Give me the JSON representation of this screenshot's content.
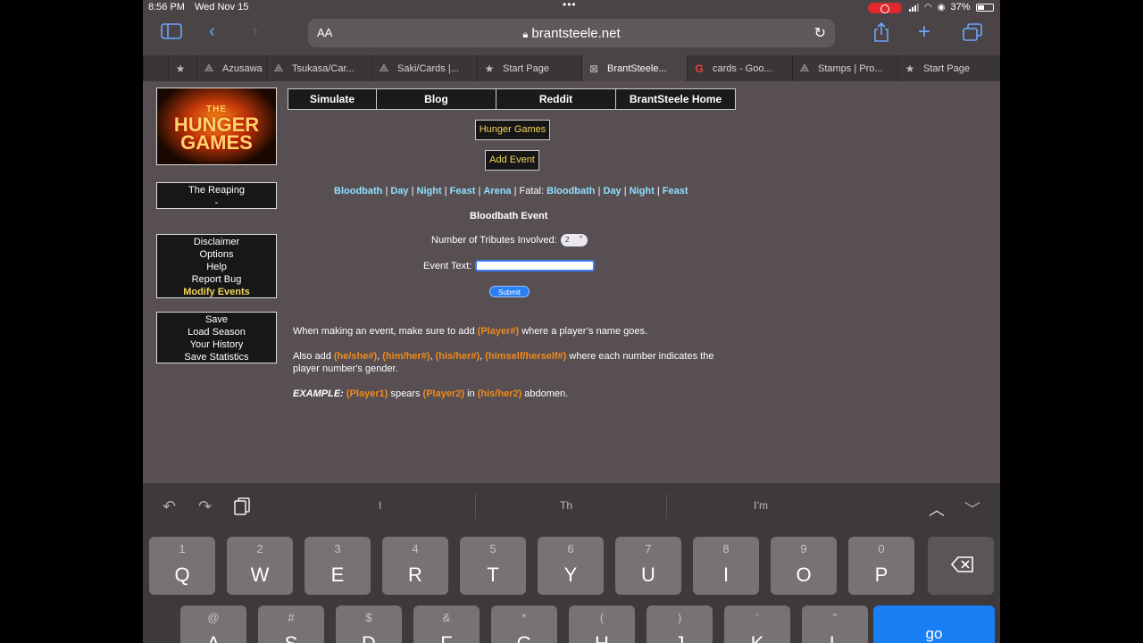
{
  "status": {
    "time": "8:56 PM",
    "date": "Wed Nov 15",
    "battery": "37%"
  },
  "browser": {
    "url": "brantsteele.net",
    "aa_label": "AA",
    "tabs": [
      {
        "label": "",
        "icon": "star-icon"
      },
      {
        "label": "Azusawa",
        "icon": "site-icon"
      },
      {
        "label": "Tsukasa/Car...",
        "icon": "site-icon"
      },
      {
        "label": "Saki/Cards |...",
        "icon": "site-icon"
      },
      {
        "label": "Start Page",
        "icon": "star-icon"
      },
      {
        "label": "BrantSteele...",
        "icon": "close-icon",
        "active": true
      },
      {
        "label": "cards - Goo...",
        "icon": "google-icon"
      },
      {
        "label": "Stamps | Pro...",
        "icon": "site-icon"
      },
      {
        "label": "Start Page",
        "icon": "star-icon"
      }
    ]
  },
  "sidebar": {
    "logo": {
      "line1": "THE",
      "line2": "HUNGER",
      "line3": "GAMES"
    },
    "reaping": {
      "title": "The Reaping",
      "sub": "-"
    },
    "menu": [
      "Disclaimer",
      "Options",
      "Help",
      "Report Bug",
      "Modify Events"
    ],
    "save_menu": [
      "Save",
      "Load Season",
      "Your History",
      "Save Statistics"
    ]
  },
  "nav": [
    "Simulate",
    "Blog",
    "Reddit",
    "BrantSteele Home"
  ],
  "buttons": {
    "hunger_games": "Hunger Games",
    "add_event": "Add Event"
  },
  "links": {
    "bloodbath": "Bloodbath",
    "day": "Day",
    "night": "Night",
    "feast": "Feast",
    "arena": "Arena",
    "fatal_label": "Fatal:",
    "sep": "|"
  },
  "form": {
    "heading": "Bloodbath Event",
    "tributes_label": "Number of Tributes Involved:",
    "tributes_value": "2",
    "event_text_label": "Event Text:",
    "submit": "Submit"
  },
  "instructions": {
    "p1_a": "When making an event, make sure to add ",
    "p1_tag": "(Player#)",
    "p1_b": " where a player’s name goes.",
    "p2_a": "Also add ",
    "p2_t1": "(he/she#)",
    "p2_t2": "(him/her#)",
    "p2_t3": "(his/her#)",
    "p2_t4": "(himself/herself#)",
    "comma": ", ",
    "p2_b": " where each number indicates the player number's gender.",
    "ex_label": "EXAMPLE:",
    "ex_t1": "(Player1)",
    "ex_w1": " spears ",
    "ex_t2": "(Player2)",
    "ex_w2": " in ",
    "ex_t3": "(his/her2)",
    "ex_w3": " abdomen."
  },
  "keyboard": {
    "suggestions": [
      "I",
      "Th",
      "I’m"
    ],
    "row1": [
      {
        "sub": "1",
        "main": "Q"
      },
      {
        "sub": "2",
        "main": "W"
      },
      {
        "sub": "3",
        "main": "E"
      },
      {
        "sub": "4",
        "main": "R"
      },
      {
        "sub": "5",
        "main": "T"
      },
      {
        "sub": "6",
        "main": "Y"
      },
      {
        "sub": "7",
        "main": "U"
      },
      {
        "sub": "8",
        "main": "I"
      },
      {
        "sub": "9",
        "main": "O"
      },
      {
        "sub": "0",
        "main": "P"
      }
    ],
    "row2": [
      {
        "sub": "@",
        "main": "A"
      },
      {
        "sub": "#",
        "main": "S"
      },
      {
        "sub": "$",
        "main": "D"
      },
      {
        "sub": "&",
        "main": "F"
      },
      {
        "sub": "*",
        "main": "G"
      },
      {
        "sub": "(",
        "main": "H"
      },
      {
        "sub": ")",
        "main": "J"
      },
      {
        "sub": "’",
        "main": "K"
      },
      {
        "sub": "\"",
        "main": "L"
      }
    ],
    "go": "go"
  }
}
